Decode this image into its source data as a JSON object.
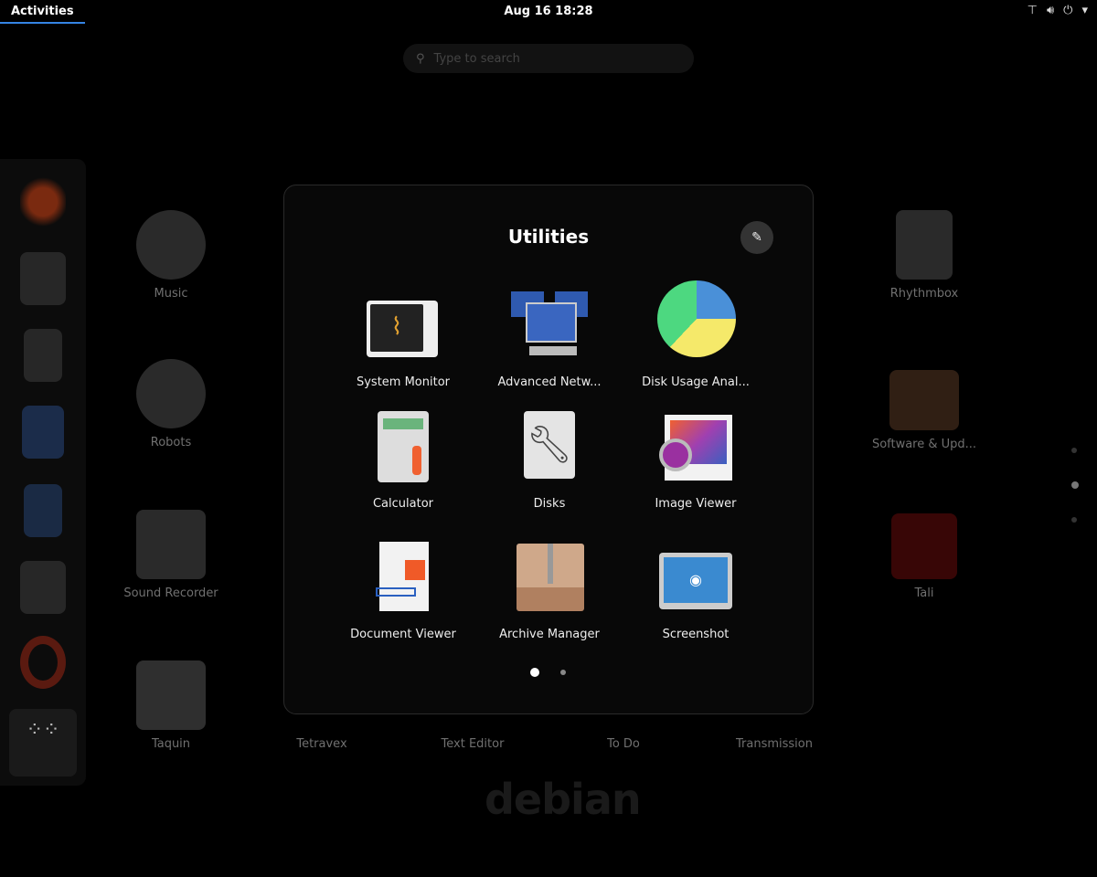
{
  "topbar": {
    "activities": "Activities",
    "clock": "Aug 16  18:28",
    "icons": [
      "network-icon",
      "volume-icon",
      "power-icon",
      "chevron-down-icon"
    ]
  },
  "search": {
    "placeholder": "Type to search"
  },
  "dock": {
    "items": [
      "firefox",
      "evolution",
      "rhythmbox",
      "libreoffice-writer",
      "text-editor",
      "software",
      "help",
      "show-apps"
    ]
  },
  "background_apps": [
    {
      "label": "Music"
    },
    {
      "label": "Robots"
    },
    {
      "label": "Sound Recorder"
    },
    {
      "label": "Taquin"
    },
    {
      "label": "Tetravex"
    },
    {
      "label": "Text Editor"
    },
    {
      "label": "To Do"
    },
    {
      "label": "Transmission"
    },
    {
      "label": "Rhythmbox"
    },
    {
      "label": "Software & Upd..."
    },
    {
      "label": "Tali"
    }
  ],
  "folder": {
    "title": "Utilities",
    "apps": [
      {
        "label": "System Monitor"
      },
      {
        "label": "Advanced Netw..."
      },
      {
        "label": "Disk Usage Anal..."
      },
      {
        "label": "Calculator"
      },
      {
        "label": "Disks"
      },
      {
        "label": "Image Viewer"
      },
      {
        "label": "Document Viewer"
      },
      {
        "label": "Archive Manager"
      },
      {
        "label": "Screenshot"
      }
    ],
    "pages": 2,
    "current_page": 1
  },
  "wallpaper": {
    "logo": "debian"
  }
}
